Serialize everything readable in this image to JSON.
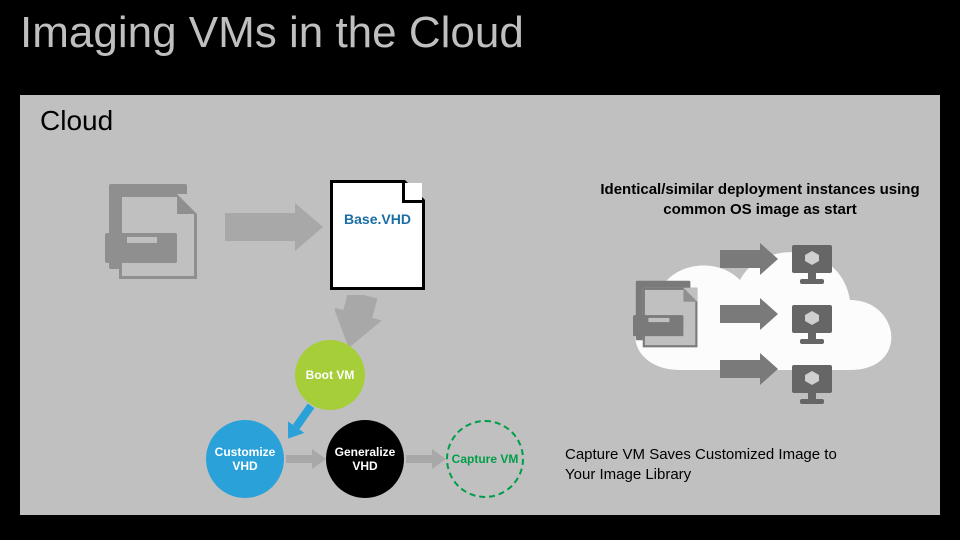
{
  "title": "Imaging VMs in the Cloud",
  "panel": {
    "label": "Cloud",
    "caption_top": "Identical/similar deployment instances using common OS image as start",
    "base_vhd_label": "Base.VHD",
    "steps": {
      "boot": "Boot VM",
      "customize": "Customize VHD",
      "generalize": "Generalize VHD",
      "capture": "Capture VM"
    },
    "caption_bottom": "Capture VM Saves Customized Image to Your Image Library"
  },
  "colors": {
    "boot": "#a6ce39",
    "customize": "#2aa1d8",
    "generalize": "#000000",
    "capture_border": "#009e49",
    "accent_text": "#1b6ea5"
  }
}
